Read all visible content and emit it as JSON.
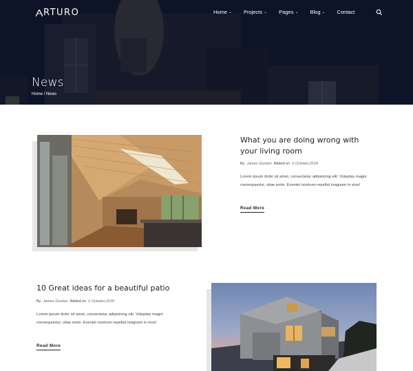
{
  "brand": {
    "logo_text": "RTURO"
  },
  "nav": {
    "items": [
      {
        "label": "Home",
        "has_dropdown": true
      },
      {
        "label": "Projects",
        "has_dropdown": true
      },
      {
        "label": "Pages",
        "has_dropdown": true
      },
      {
        "label": "Blog",
        "has_dropdown": true
      },
      {
        "label": "Contact",
        "has_dropdown": false
      }
    ],
    "search_icon": "search-icon"
  },
  "hero": {
    "title": "News",
    "breadcrumb": {
      "home": "Home",
      "separator": " / ",
      "current": "News"
    }
  },
  "posts": [
    {
      "title": "What you are doing wrong with your living room",
      "meta_by": "By",
      "author": "James Gordon",
      "added_on": "Added on",
      "date": "6 October,2018",
      "excerpt": "Lorem ipsum dolor sit amet, consectetur adipisicing elit. Voluptas magni consequuntur, vitae enim. Eveniet nostrum repellat magnam in eius!",
      "read_more": "Read More"
    },
    {
      "title": "10 Great ideas for a beautiful patio",
      "meta_by": "By",
      "author": "James Gordon",
      "added_on": "Added on",
      "date": "6 October,2018",
      "excerpt": "Lorem ipsum dolor sit amet, consectetur adipisicing elit. Voluptas magni consequuntur, vitae enim. Eveniet nostrum repellat magnam in eius!",
      "read_more": "Read More"
    }
  ],
  "colors": {
    "hero_bg": "#141c30",
    "text": "#222222",
    "shadow": "#e6e6e6"
  }
}
